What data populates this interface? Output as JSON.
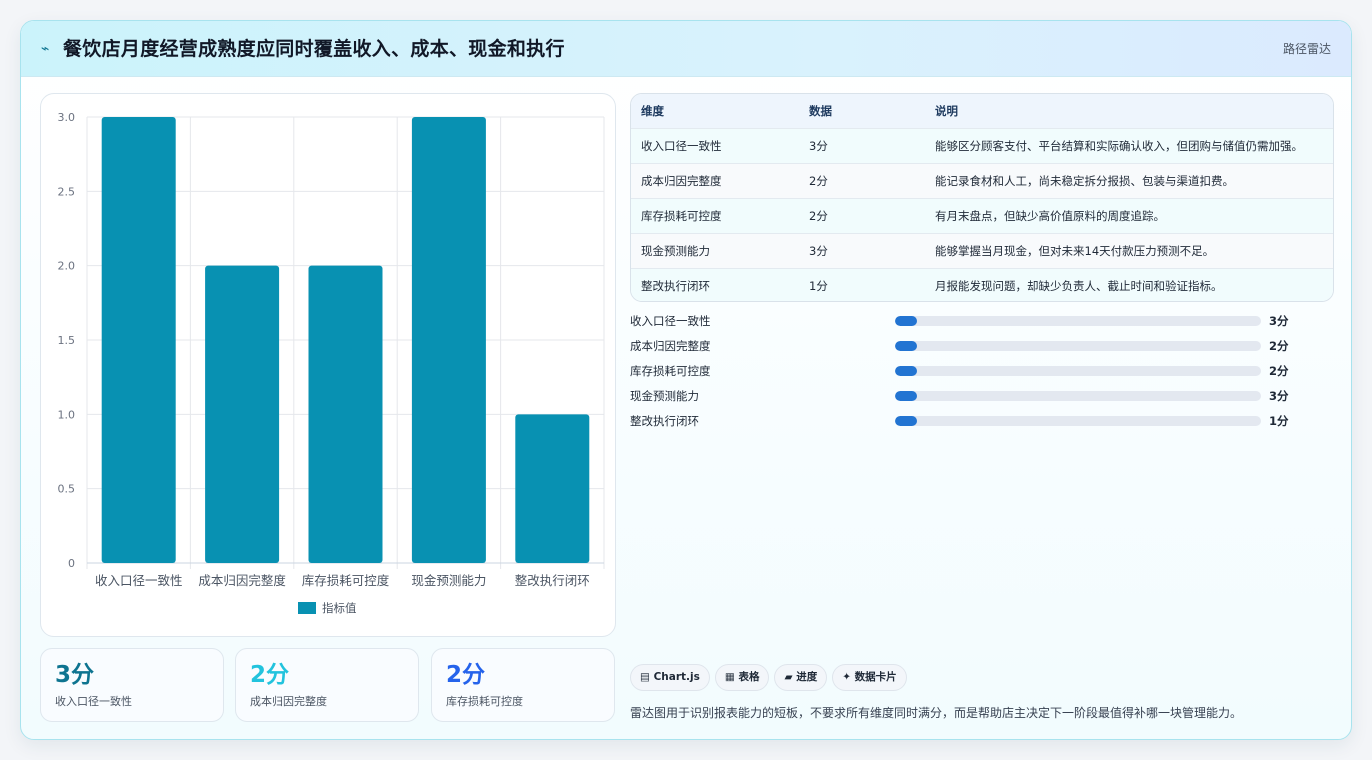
{
  "header": {
    "icon": "pulse-icon",
    "title": "餐饮店月度经营成熟度应同时覆盖收入、成本、现金和执行",
    "route_label": "路径雷达"
  },
  "chart_data": {
    "type": "bar",
    "categories": [
      "收入口径一致性",
      "成本归因完整度",
      "库存损耗可控度",
      "现金预测能力",
      "整改执行闭环"
    ],
    "series": [
      {
        "name": "指标值",
        "values": [
          3,
          2,
          2,
          3,
          1
        ]
      }
    ],
    "ylim": [
      0,
      3
    ],
    "yticks": [
      "3.0",
      "2.5",
      "2.0",
      "1.5",
      "1.0",
      "0.5",
      "0"
    ],
    "ytick_values": [
      3,
      2.5,
      2,
      1.5,
      1,
      0.5,
      0
    ],
    "grid": true,
    "legend_position": "bottom",
    "bar_color": "#0891b2"
  },
  "stats": [
    {
      "value": "3分",
      "label": "收入口径一致性",
      "color": "#0e7490"
    },
    {
      "value": "2分",
      "label": "成本归因完整度",
      "color": "#22c3dd"
    },
    {
      "value": "2分",
      "label": "库存损耗可控度",
      "color": "#2563eb"
    }
  ],
  "table": {
    "headers": [
      "维度",
      "数据",
      "说明"
    ],
    "rows": [
      [
        "收入口径一致性",
        "3分",
        "能够区分顾客支付、平台结算和实际确认收入，但团购与储值仍需加强。"
      ],
      [
        "成本归因完整度",
        "2分",
        "能记录食材和人工，尚未稳定拆分报损、包装与渠道扣费。"
      ],
      [
        "库存损耗可控度",
        "2分",
        "有月末盘点，但缺少高价值原料的周度追踪。"
      ],
      [
        "现金预测能力",
        "3分",
        "能够掌握当月现金，但对未来14天付款压力预测不足。"
      ],
      [
        "整改执行闭环",
        "1分",
        "月报能发现问题，却缺少负责人、截止时间和验证指标。"
      ]
    ]
  },
  "progress": [
    {
      "label": "收入口径一致性",
      "value": "3分",
      "fraction": 0.06
    },
    {
      "label": "成本归因完整度",
      "value": "2分",
      "fraction": 0.06
    },
    {
      "label": "库存损耗可控度",
      "value": "2分",
      "fraction": 0.06
    },
    {
      "label": "现金预测能力",
      "value": "3分",
      "fraction": 0.06
    },
    {
      "label": "整改执行闭环",
      "value": "1分",
      "fraction": 0.06
    }
  ],
  "tags": [
    {
      "icon": "chart-icon",
      "glyph": "▤",
      "label": "Chart.js"
    },
    {
      "icon": "table-icon",
      "glyph": "▦",
      "label": "表格"
    },
    {
      "icon": "progress-icon",
      "glyph": "▰",
      "label": "进度"
    },
    {
      "icon": "sparkle-icon",
      "glyph": "✦",
      "label": "数据卡片"
    }
  ],
  "note": "雷达图用于识别报表能力的短板，不要求所有维度同时满分，而是帮助店主决定下一阶段最值得补哪一块管理能力。"
}
